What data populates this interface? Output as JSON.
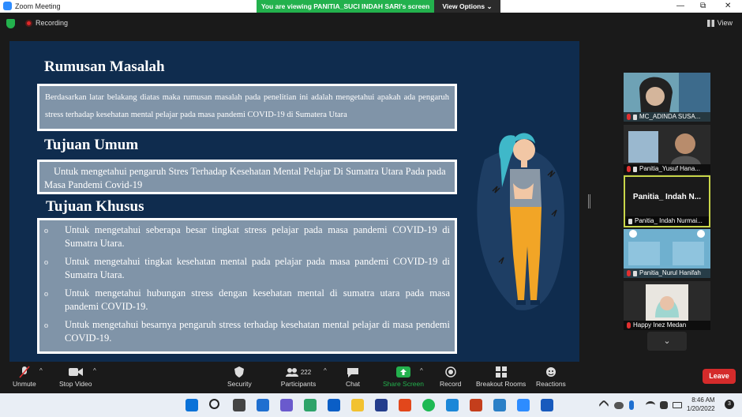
{
  "titlebar": {
    "app_name": "Zoom Meeting",
    "banner": "You are viewing PANITIA_SUCI INDAH SARI's screen",
    "view_options": "View Options ⌄",
    "minimize": "—",
    "maximize": "⧉",
    "close": "✕"
  },
  "topbar": {
    "recording": "Recording",
    "view": "View"
  },
  "slide": {
    "heading1": "Rumusan Masalah",
    "box1": "Berdasarkan latar belakang diatas maka rumusan masalah pada penelitian ini adalah mengetahui apakah ada pengaruh stress terhadap kesehatan mental pelajar pada masa pandemi COVID-19 di Sumatera Utara",
    "heading2": "Tujuan Umum",
    "box2": "Untuk mengetahui pengaruh Stres Terhadap Kesehatan Mental Pelajar Di Sumatra Utara Pada pada Masa Pandemi Covid-19",
    "heading3": "Tujuan Khusus",
    "bullets": [
      {
        "marker": "o",
        "text": "Untuk mengetahui seberapa besar tingkat stress pelajar pada masa pandemi COVID-19 di Sumatra Utara."
      },
      {
        "marker": "o",
        "text": "Untuk mengetahui tingkat kesehatan mental pada pelajar pada masa pandemi COVID-19 di Sumatra Utara."
      },
      {
        "marker": "o",
        "text": "Untuk mengetahui hubungan stress dengan kesehatan mental di sumatra utara pada masa pandemi COVID-19."
      },
      {
        "marker": "o",
        "text": "Untuk mengetahui besarnya pengaruh stress terhadap kesehatan mental pelajar di masa pendemi COVID-19."
      }
    ]
  },
  "gallery": {
    "participants": [
      {
        "name": "MC_ADINDA SUSA..."
      },
      {
        "name": "Panitia_Yusuf Hana..."
      },
      {
        "name": "Panitia_ Indah Nurmai...",
        "big": "Panitia_ Indah N..."
      },
      {
        "name": "Panitia_Nurul Hanifah"
      },
      {
        "name": "Happy Inez Medan"
      }
    ],
    "scroll_down": "⌄"
  },
  "toolbar": {
    "unmute": "Unmute",
    "stop_video": "Stop Video",
    "security": "Security",
    "participants": "Participants",
    "participants_count": "222",
    "chat": "Chat",
    "share_screen": "Share Screen",
    "record": "Record",
    "breakout": "Breakout Rooms",
    "reactions": "Reactions",
    "leave": "Leave"
  },
  "taskbar": {
    "time": "8:46 AM",
    "date": "1/20/2022",
    "notif_count": "3"
  },
  "colors": {
    "slide_bg": "#0f2c4e",
    "box_bg": "#8094a8",
    "share_green": "#23b14d",
    "leave_red": "#d42b2b"
  }
}
